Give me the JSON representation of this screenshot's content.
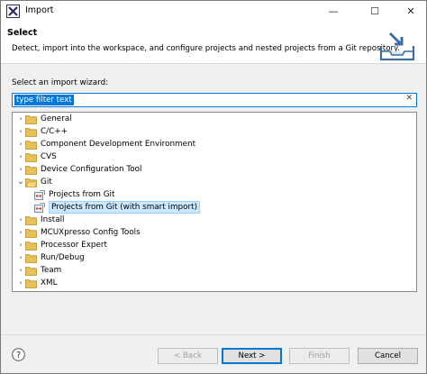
{
  "window": {
    "title": "Import",
    "minimize_symbol": "—",
    "maximize_symbol": "☐",
    "close_symbol": "✕"
  },
  "header": {
    "title": "Select",
    "description": "Detect, import into the workspace, and configure projects and nested projects from a Git repository."
  },
  "wizard": {
    "label": "Select an import wizard:",
    "filter_value": "type filter text",
    "clear_symbol": "✕"
  },
  "tree": {
    "items": [
      {
        "label": "General",
        "expanded": false,
        "icon": "folder-icon"
      },
      {
        "label": "C/C++",
        "expanded": false,
        "icon": "folder-icon"
      },
      {
        "label": "Component Development Environment",
        "expanded": false,
        "icon": "folder-icon"
      },
      {
        "label": "CVS",
        "expanded": false,
        "icon": "folder-icon"
      },
      {
        "label": "Device Configuration Tool",
        "expanded": false,
        "icon": "folder-icon"
      },
      {
        "label": "Git",
        "expanded": true,
        "icon": "folder-open-icon"
      },
      {
        "label": "Projects from Git",
        "child": true,
        "icon": "git-projects-icon"
      },
      {
        "label": "Projects from Git (with smart import)",
        "child": true,
        "selected": true,
        "icon": "git-projects-icon"
      },
      {
        "label": "Install",
        "expanded": false,
        "icon": "folder-icon"
      },
      {
        "label": "MCUXpresso Config Tools",
        "expanded": false,
        "icon": "folder-icon"
      },
      {
        "label": "Processor Expert",
        "expanded": false,
        "icon": "folder-icon"
      },
      {
        "label": "Run/Debug",
        "expanded": false,
        "icon": "folder-icon"
      },
      {
        "label": "Team",
        "expanded": false,
        "icon": "folder-icon"
      },
      {
        "label": "XML",
        "expanded": false,
        "icon": "folder-icon"
      }
    ]
  },
  "footer": {
    "help_symbol": "?",
    "back_label": "< Back",
    "next_label": "Next >",
    "finish_label": "Finish",
    "cancel_label": "Cancel"
  },
  "colors": {
    "accent": "#0078d7",
    "folder": "#e8c15b",
    "selection": "#cce8ff"
  }
}
